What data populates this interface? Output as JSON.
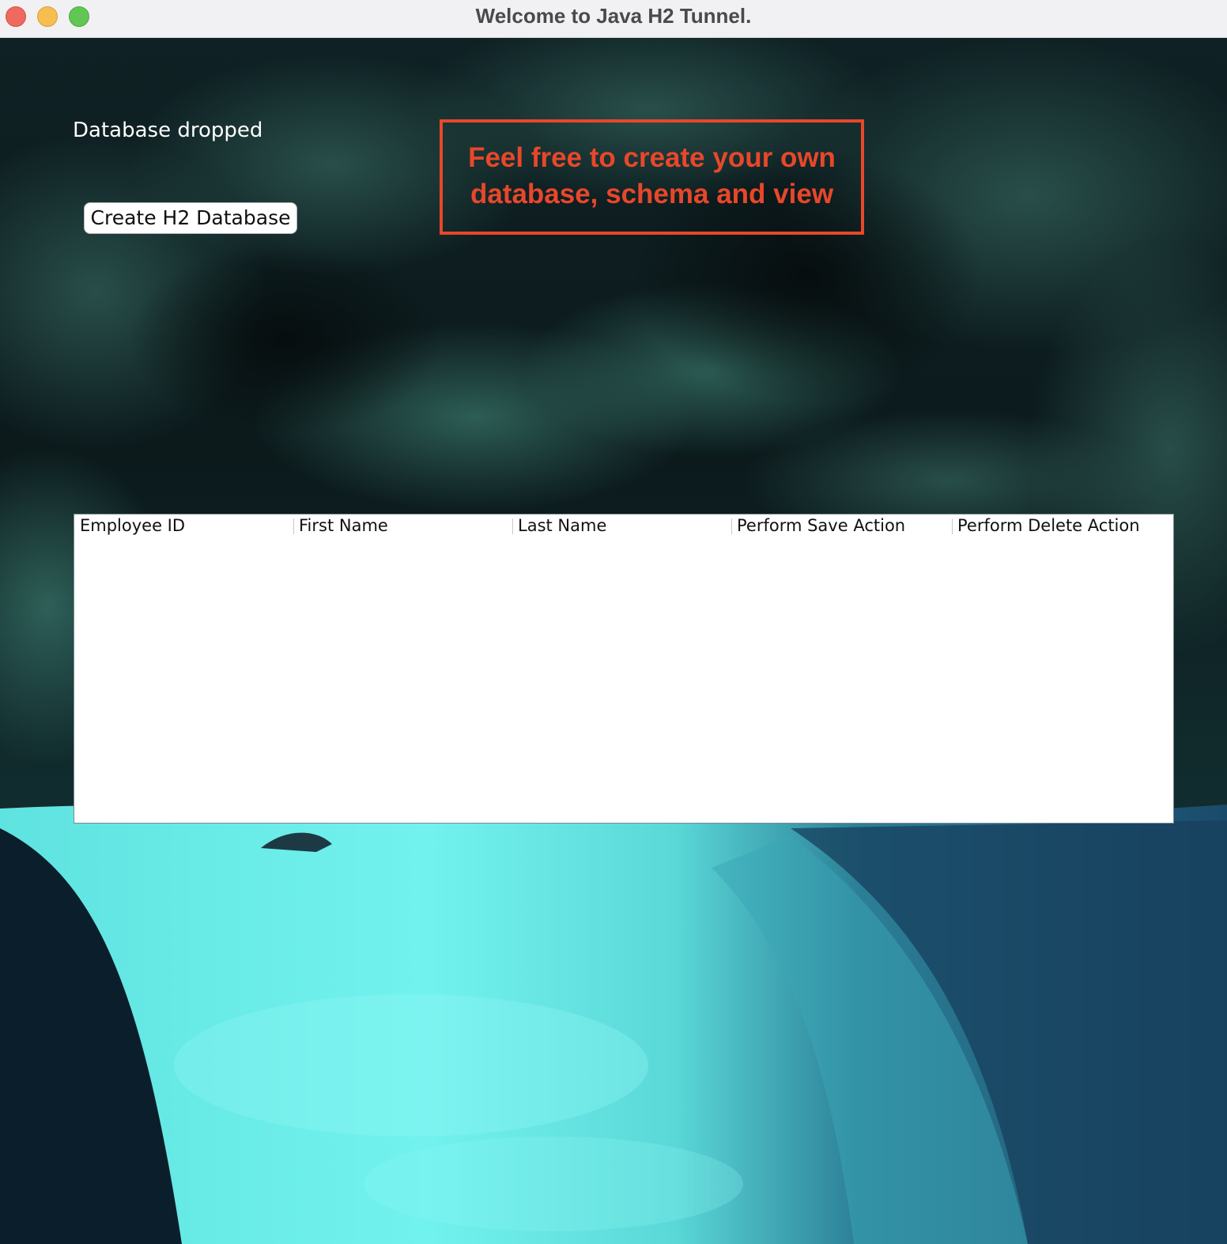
{
  "window": {
    "title": "Welcome to Java H2 Tunnel."
  },
  "status": {
    "message": "Database dropped"
  },
  "actions": {
    "create_label": "Create H2 Database"
  },
  "banner": {
    "line1": "Feel free to create your own",
    "line2": "database, schema and view",
    "color": "#e8472a"
  },
  "table": {
    "columns": [
      "Employee ID",
      "First Name",
      "Last Name",
      "Perform Save Action",
      "Perform Delete Action"
    ],
    "rows": []
  },
  "theme": {
    "background_dark": "#0d1d1f",
    "water": "#6ff1ee"
  }
}
